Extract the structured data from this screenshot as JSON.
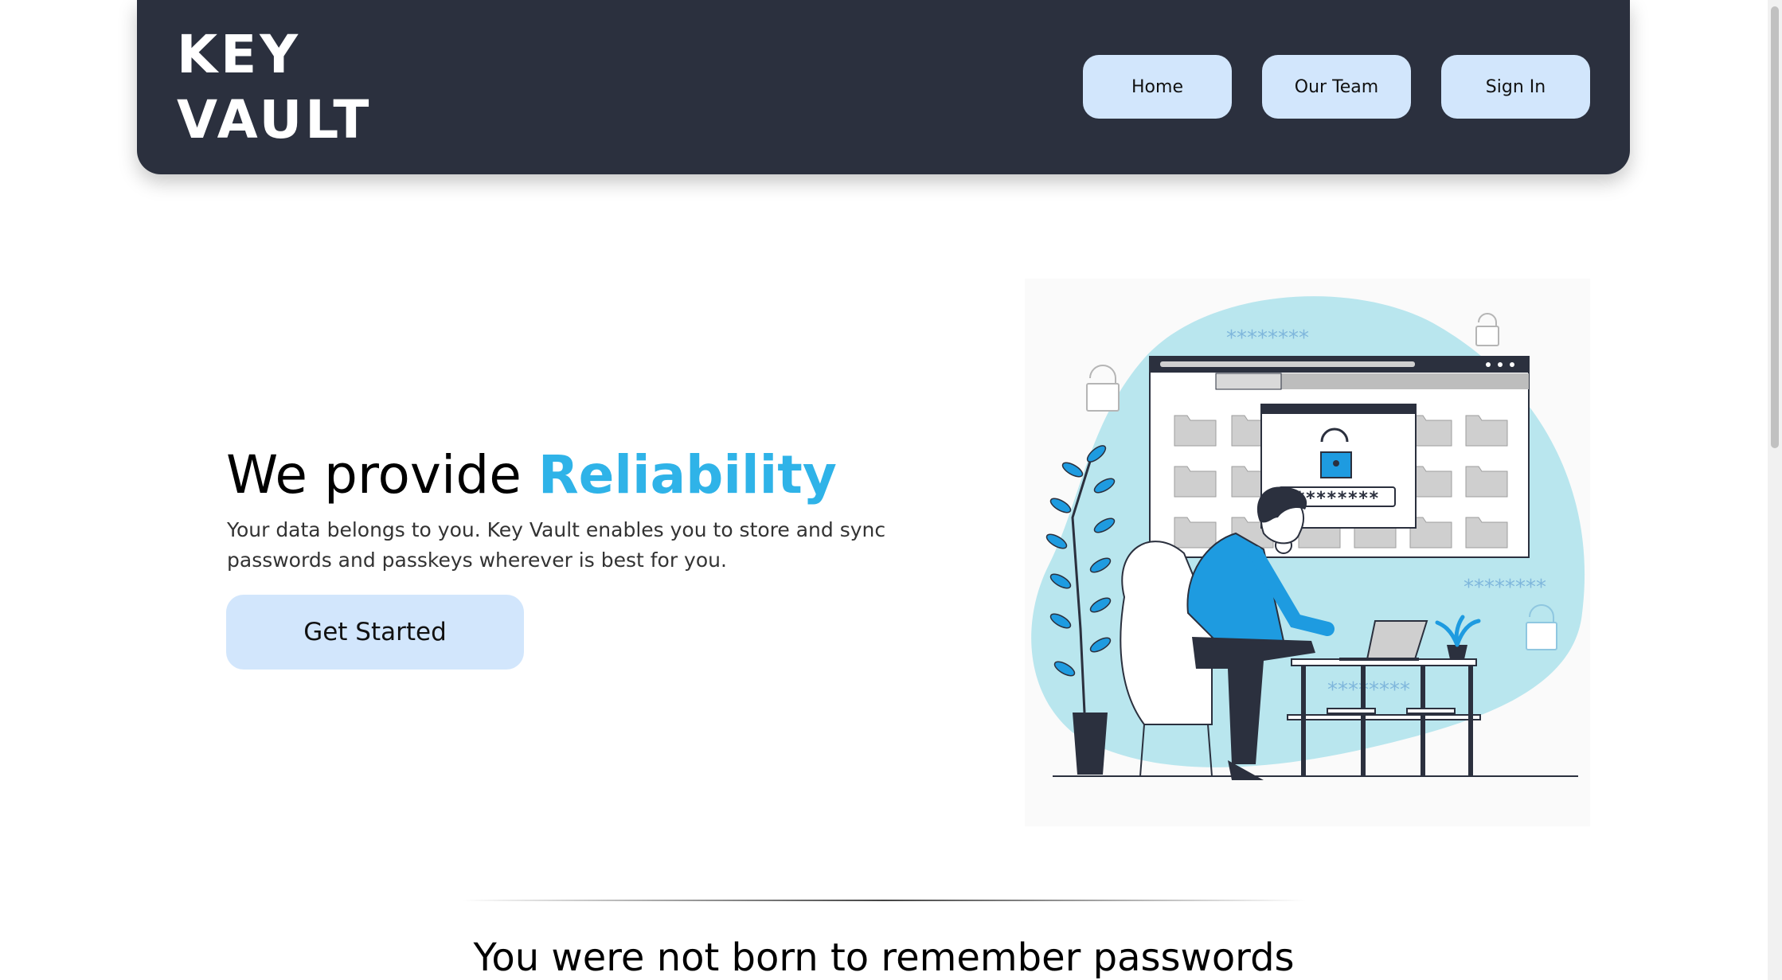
{
  "header": {
    "logo_line1": "KEY",
    "logo_line2": "VAULT",
    "nav": {
      "home": "Home",
      "team": "Our Team",
      "signin": "Sign In"
    }
  },
  "hero": {
    "title_prefix": "We provide ",
    "title_accent": "Reliability",
    "description": "Your data belongs to you. Key Vault enables you to store and sync passwords and passkeys wherever is best for you.",
    "cta": "Get Started"
  },
  "illustration": {
    "masked_password": "********",
    "masked_top": "********",
    "masked_right": "********",
    "masked_bottom": "********"
  },
  "section": {
    "title": "You were not born to remember passwords"
  },
  "colors": {
    "header_bg": "#2b303e",
    "button_bg": "#d2e6fc",
    "accent": "#2fb3e8"
  }
}
